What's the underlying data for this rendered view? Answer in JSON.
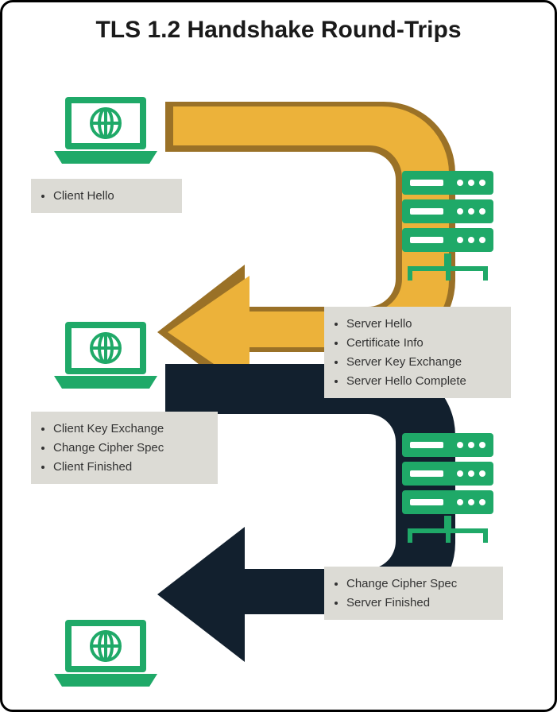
{
  "title": "TLS 1.2 Handshake Round-Trips",
  "colors": {
    "accent_green": "#1fa968",
    "arrow_front": "#ecb23a",
    "arrow_outline": "#9a7127",
    "arrow_dark": "#12202e",
    "box_bg": "#dcdbd5"
  },
  "steps": {
    "client1": {
      "items": [
        "Client Hello"
      ]
    },
    "server1": {
      "items": [
        "Server Hello",
        "Certificate Info",
        "Server Key Exchange",
        "Server Hello Complete"
      ]
    },
    "client2": {
      "items": [
        "Client Key Exchange",
        "Change Cipher Spec",
        "Client Finished"
      ]
    },
    "server2": {
      "items": [
        "Change Cipher Spec",
        "Server Finished"
      ]
    }
  }
}
